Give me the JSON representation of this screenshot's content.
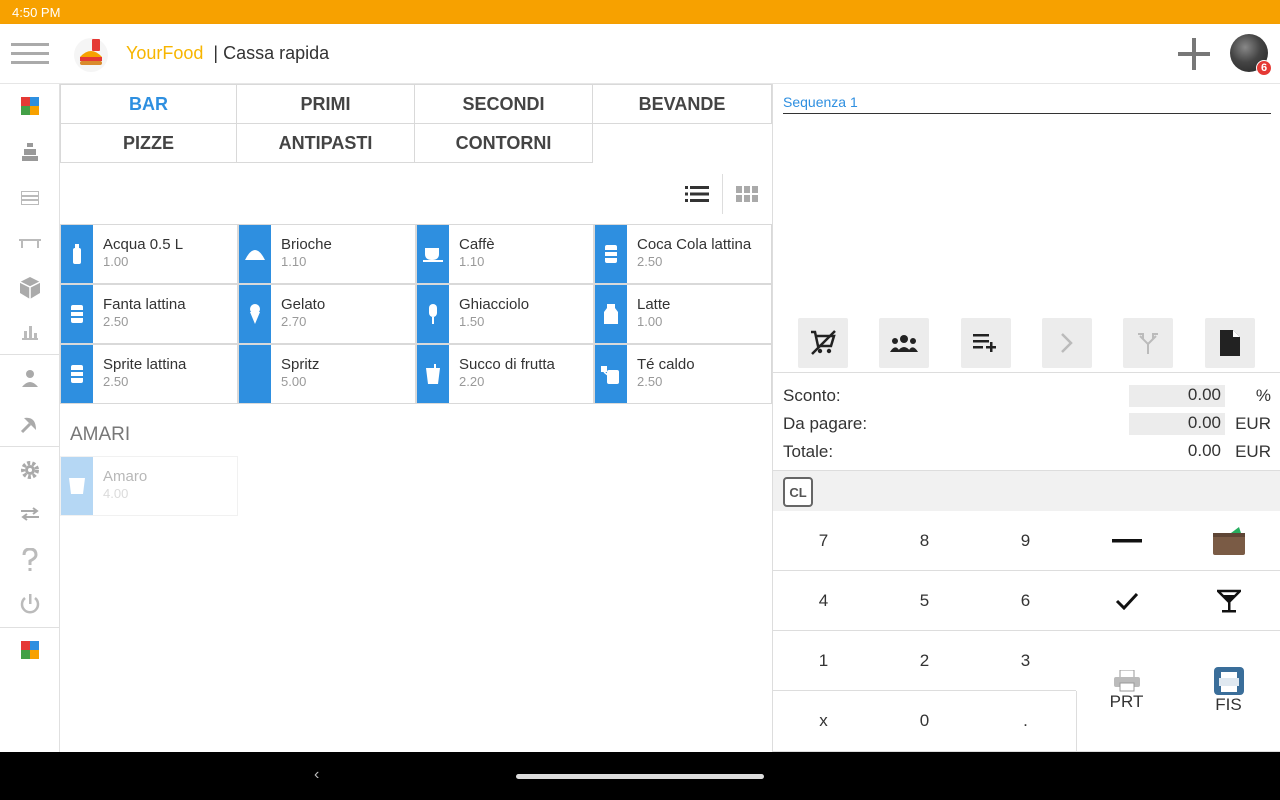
{
  "status": {
    "time": "4:50 PM"
  },
  "header": {
    "brand": "YourFood",
    "title": "| Cassa rapida",
    "badge_count": "6"
  },
  "categories": [
    {
      "label": "BAR",
      "active": true
    },
    {
      "label": "PRIMI"
    },
    {
      "label": "SECONDI"
    },
    {
      "label": "BEVANDE"
    },
    {
      "label": "PIZZE"
    },
    {
      "label": "ANTIPASTI"
    },
    {
      "label": "CONTORNI"
    }
  ],
  "products": [
    {
      "name": "Acqua 0.5 L",
      "price": "1.00",
      "icon": "bottle-icon"
    },
    {
      "name": "Brioche",
      "price": "1.10",
      "icon": "croissant-icon"
    },
    {
      "name": "Caffè",
      "price": "1.10",
      "icon": "coffee-icon"
    },
    {
      "name": "Coca Cola lattina",
      "price": "2.50",
      "icon": "can-icon"
    },
    {
      "name": "Fanta lattina",
      "price": "2.50",
      "icon": "can-icon"
    },
    {
      "name": "Gelato",
      "price": "2.70",
      "icon": "ice-cream-icon"
    },
    {
      "name": "Ghiacciolo",
      "price": "1.50",
      "icon": "popsicle-icon"
    },
    {
      "name": "Latte",
      "price": "1.00",
      "icon": "milk-icon"
    },
    {
      "name": "Sprite lattina",
      "price": "2.50",
      "icon": "can-icon"
    },
    {
      "name": "Spritz",
      "price": "5.00",
      "icon": "none"
    },
    {
      "name": "Succo di frutta",
      "price": "2.20",
      "icon": "juice-icon"
    },
    {
      "name": "Té caldo",
      "price": "2.50",
      "icon": "tea-icon"
    }
  ],
  "section": {
    "title": "AMARI",
    "products": [
      {
        "name": "Amaro",
        "price": "4.00",
        "icon": "glass-icon"
      }
    ]
  },
  "order": {
    "sequence": "Sequenza 1"
  },
  "totals": {
    "discount_label": "Sconto:",
    "discount_value": "0.00",
    "discount_unit": "%",
    "due_label": "Da pagare:",
    "due_value": "0.00",
    "due_unit": "EUR",
    "total_label": "Totale:",
    "total_value": "0.00",
    "total_unit": "EUR"
  },
  "keypad": {
    "clear": "CL",
    "k7": "7",
    "k8": "8",
    "k9": "9",
    "k4": "4",
    "k5": "5",
    "k6": "6",
    "k1": "1",
    "k2": "2",
    "k3": "3",
    "kx": "x",
    "k0": "0",
    "kdot": ".",
    "prt": "PRT",
    "fis": "FIS"
  },
  "colors": {
    "accent": "#2e8fe0",
    "statusbar": "#f7a100",
    "brand": "#f7b500"
  }
}
